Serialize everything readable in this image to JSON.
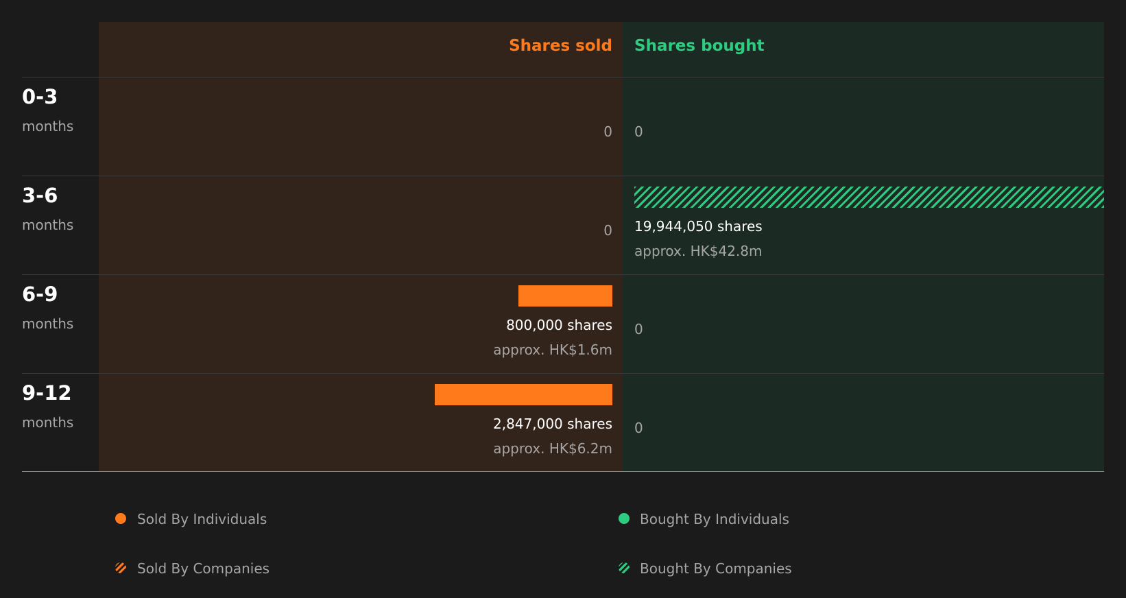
{
  "colors": {
    "sold": "#ff7a1a",
    "bought": "#2ecc80",
    "sold_bg": "#33241b",
    "bought_bg": "#1c2a24",
    "background": "#1b1b1b"
  },
  "chart_data": {
    "type": "bar",
    "orientation": "horizontal-diverging",
    "headers": {
      "sold": "Shares sold",
      "bought": "Shares bought"
    },
    "categories": [
      {
        "label": "0-3",
        "unit": "months"
      },
      {
        "label": "3-6",
        "unit": "months"
      },
      {
        "label": "6-9",
        "unit": "months"
      },
      {
        "label": "9-12",
        "unit": "months"
      }
    ],
    "rows": [
      {
        "sold": {
          "value": 0,
          "text": "0"
        },
        "bought": {
          "value": 0,
          "text": "0"
        }
      },
      {
        "sold": {
          "value": 0,
          "text": "0"
        },
        "bought": {
          "value": 19944050,
          "by": "companies",
          "shares_text": "19,944,050 shares",
          "approx_text": "approx. HK$42.8m"
        }
      },
      {
        "sold": {
          "value": 800000,
          "by": "individuals",
          "shares_text": "800,000 shares",
          "approx_text": "approx. HK$1.6m"
        },
        "bought": {
          "value": 0,
          "text": "0"
        }
      },
      {
        "sold": {
          "value": 2847000,
          "by": "individuals",
          "shares_text": "2,847,000 shares",
          "approx_text": "approx. HK$6.2m"
        },
        "bought": {
          "value": 0,
          "text": "0"
        }
      }
    ],
    "legend": [
      {
        "label": "Sold By Individuals",
        "icon": "orange-dot-icon"
      },
      {
        "label": "Bought By Individuals",
        "icon": "green-dot-icon"
      },
      {
        "label": "Sold By Companies",
        "icon": "orange-hatched-dot-icon"
      },
      {
        "label": "Bought By Companies",
        "icon": "green-hatched-dot-icon"
      }
    ],
    "legend_placement": "bottom"
  }
}
